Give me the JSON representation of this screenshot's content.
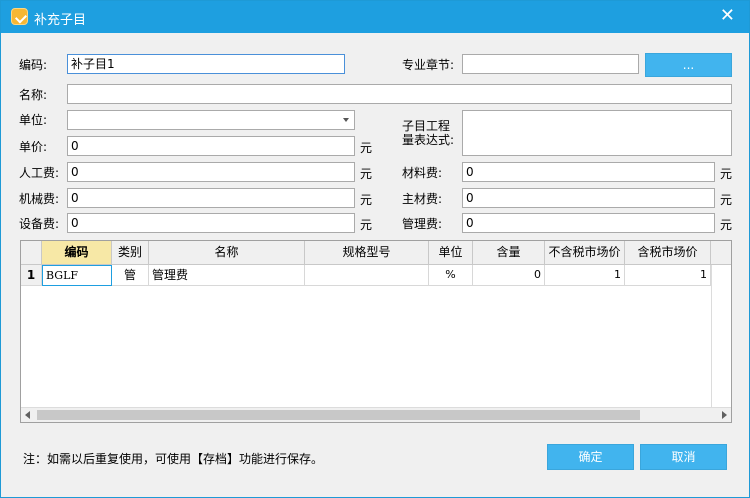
{
  "window": {
    "title": "补充子目",
    "close_glyph": "✕"
  },
  "form": {
    "code_label": "编码:",
    "code_value": "补子目1",
    "chapter_label": "专业章节:",
    "chapter_value": "",
    "browse_label": "...",
    "name_label": "名称:",
    "name_value": "",
    "unit_label": "单位:",
    "unit_value": "",
    "price_label": "单价:",
    "price_value": "0",
    "labor_label": "人工费:",
    "labor_value": "0",
    "machine_label": "机械费:",
    "machine_value": "0",
    "equipment_label": "设备费:",
    "equipment_value": "0",
    "expr_label_line1": "子目工程",
    "expr_label_line2": "量表达式:",
    "expr_value": "",
    "material_label": "材料费:",
    "material_value": "0",
    "main_material_label": "主材费:",
    "main_material_value": "0",
    "mgmt_label": "管理费:",
    "mgmt_value": "0",
    "currency": "元"
  },
  "table": {
    "headers": [
      "编码",
      "类别",
      "名称",
      "规格型号",
      "单位",
      "含量",
      "不含税市场价",
      "含税市场价"
    ],
    "rows": [
      {
        "num": "1",
        "code": "BGLF",
        "category": "管",
        "name": "管理费",
        "spec": "",
        "unit": "%",
        "qty": "0",
        "price_ex": "1",
        "price_in": "1"
      }
    ]
  },
  "footer": {
    "note": "注：如需以后重复使用，可使用【存档】功能进行保存。",
    "ok_label": "确定",
    "cancel_label": "取消"
  },
  "colors": {
    "titlebar": "#1e9fe0",
    "button": "#41b4ee",
    "active_header": "#f7e8a6"
  }
}
